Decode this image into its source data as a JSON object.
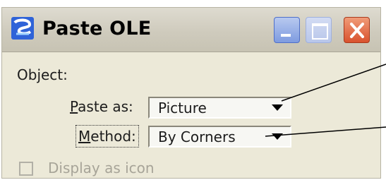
{
  "window": {
    "title": "Paste OLE"
  },
  "object_section": {
    "label": "Object:"
  },
  "paste_as": {
    "label_mnemonic": "P",
    "label_rest": "aste as:",
    "value": "Picture"
  },
  "method": {
    "label_mnemonic": "M",
    "label_rest": "ethod:",
    "value": "By Corners"
  },
  "display_as_icon": {
    "label": "Display as icon",
    "checked": false,
    "enabled": false
  },
  "colors": {
    "dialog_bg": "#ece9d8",
    "close_button": "#d9522e",
    "disabled_text": "#a7a498"
  }
}
